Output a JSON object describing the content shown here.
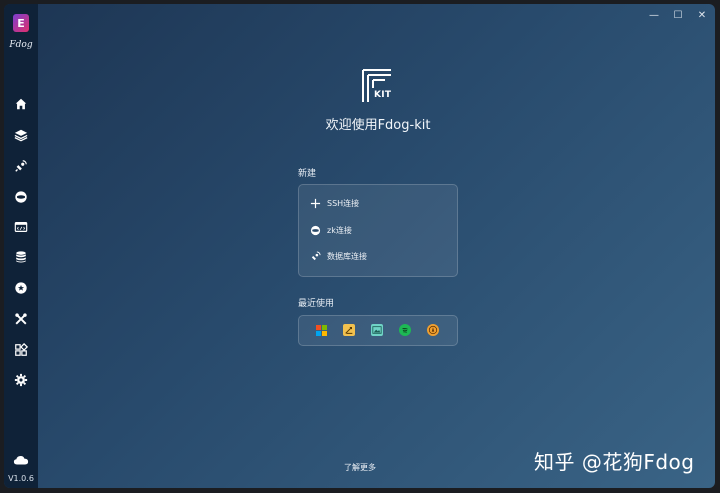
{
  "app": {
    "logo_letter": "E",
    "name": "Fdog",
    "version": "V1.0.6"
  },
  "sidebar": {
    "items": [
      {
        "icon": "home-icon"
      },
      {
        "icon": "layers-icon"
      },
      {
        "icon": "satellite-icon"
      },
      {
        "icon": "zookeeper-icon"
      },
      {
        "icon": "terminal-icon"
      },
      {
        "icon": "database-icon"
      },
      {
        "icon": "redis-icon"
      },
      {
        "icon": "tools-icon"
      },
      {
        "icon": "apps-grid-icon"
      },
      {
        "icon": "gear-icon"
      }
    ],
    "bottom_icon": "cloud-icon"
  },
  "window_controls": {
    "minimize": "—",
    "maximize": "☐",
    "close": "✕"
  },
  "hero": {
    "logo_text": "KIT",
    "welcome": "欢迎使用Fdog-kit"
  },
  "new_section": {
    "title": "新建",
    "actions": [
      {
        "label": "SSH连接",
        "icon": "plus-icon"
      },
      {
        "label": "zk连接",
        "icon": "zookeeper-icon"
      },
      {
        "label": "数据库连接",
        "icon": "database-connect-icon"
      }
    ]
  },
  "recent_section": {
    "title": "最近使用",
    "items": [
      {
        "icon": "windows-icon",
        "color": "#f25022"
      },
      {
        "icon": "notes-icon",
        "color": "#f2c14e"
      },
      {
        "icon": "image-icon",
        "color": "#6fd3c6"
      },
      {
        "icon": "spotify-icon",
        "color": "#1db954"
      },
      {
        "icon": "compass-icon",
        "color": "#f0a030"
      }
    ]
  },
  "footer": {
    "learn_more": "了解更多",
    "watermark": "知乎 @花狗Fdog"
  }
}
